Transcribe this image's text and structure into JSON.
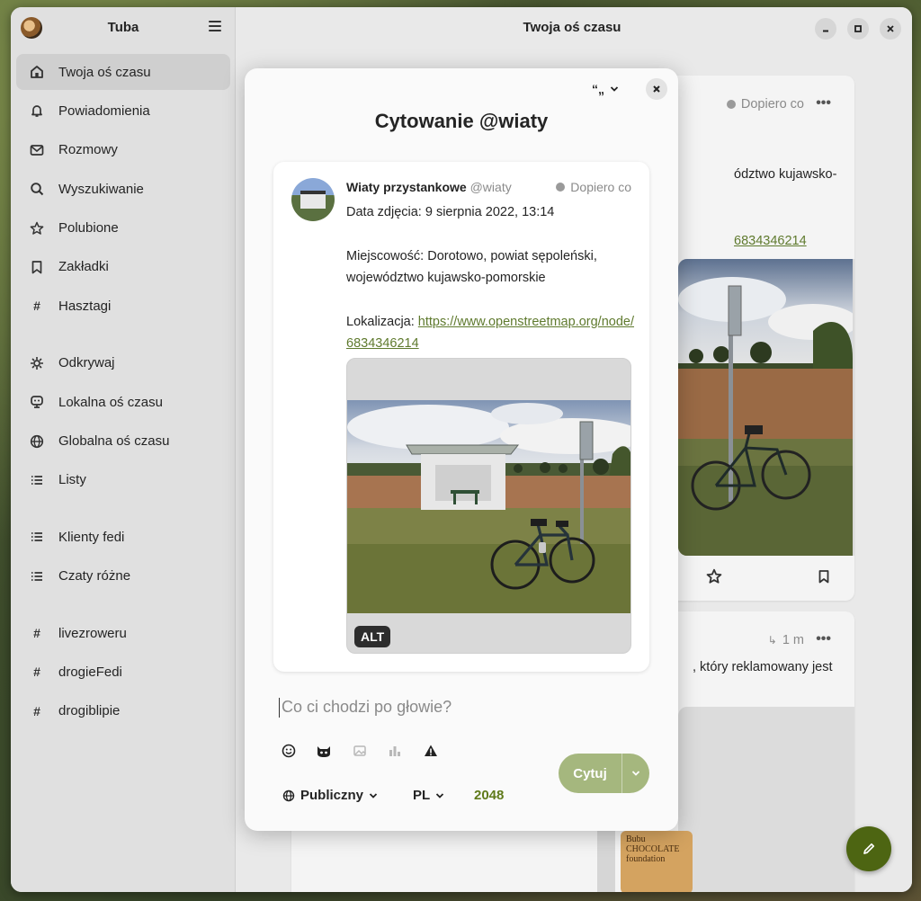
{
  "sidebar": {
    "app_title": "Tuba",
    "items": [
      {
        "label": "Twoja oś czasu",
        "icon": "home-icon"
      },
      {
        "label": "Powiadomienia",
        "icon": "bell-icon"
      },
      {
        "label": "Rozmowy",
        "icon": "envelope-icon"
      },
      {
        "label": "Wyszukiwanie",
        "icon": "search-icon"
      },
      {
        "label": "Polubione",
        "icon": "star-icon"
      },
      {
        "label": "Zakładki",
        "icon": "bookmark-icon"
      },
      {
        "label": "Hasztagi",
        "icon": "hashtag-icon"
      },
      {
        "label": "Odkrywaj",
        "icon": "compass-icon"
      },
      {
        "label": "Lokalna oś czasu",
        "icon": "local-icon"
      },
      {
        "label": "Globalna oś czasu",
        "icon": "globe-icon"
      },
      {
        "label": "Listy",
        "icon": "list-icon"
      },
      {
        "label": "Klienty fedi",
        "icon": "list-icon"
      },
      {
        "label": "Czaty różne",
        "icon": "list-icon"
      },
      {
        "label": "livezroweru",
        "icon": "hashtag-icon"
      },
      {
        "label": "drogieFedi",
        "icon": "hashtag-icon"
      },
      {
        "label": "drogiblipie",
        "icon": "hashtag-icon"
      }
    ]
  },
  "main": {
    "title": "Twoja oś czasu",
    "post1": {
      "time": "Dopiero co",
      "text_fragment": "ództwo kujawsko-",
      "link_fragment": "6834346214"
    },
    "post2": {
      "time": "1 m",
      "text_fragment": ", który reklamowany jest",
      "product_text": "Bubu CHOCOLATE foundation"
    }
  },
  "dialog": {
    "title": "Cytowanie @wiaty",
    "quote_icon": "quote-icon",
    "quoted": {
      "author_name": "Wiaty przystankowe",
      "author_handle": "@wiaty",
      "time": "Dopiero co",
      "line1": "Data zdjęcia: 9 sierpnia 2022, 13:14",
      "line2": "Miejscowość: Dorotowo, powiat sępoleński, województwo kujawsko-pomorskie",
      "line3_label": "Lokalizacja: ",
      "line3_link": "https://www.openstreetmap.org/node/6834346214",
      "alt_badge": "ALT"
    },
    "composer_placeholder": "Co ci chodzi po głowie?",
    "visibility": "Publiczny",
    "language": "PL",
    "char_count": "2048",
    "submit_label": "Cytuj"
  },
  "colors": {
    "accent": "#a5b77e",
    "fab": "#4d6512",
    "link": "#5f7a2e",
    "counter": "#5f7a1a"
  }
}
